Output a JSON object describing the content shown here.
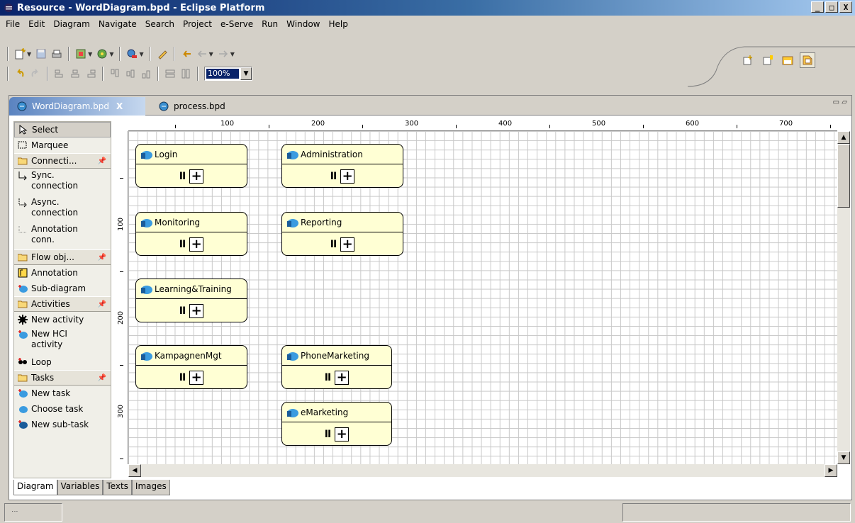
{
  "window": {
    "title": "Resource - WordDiagram.bpd - Eclipse Platform",
    "min_label": "_",
    "max_label": "□",
    "close_label": "X"
  },
  "menu": [
    {
      "label": "File"
    },
    {
      "label": "Edit"
    },
    {
      "label": "Diagram"
    },
    {
      "label": "Navigate"
    },
    {
      "label": "Search"
    },
    {
      "label": "Project"
    },
    {
      "label": "e-Serve"
    },
    {
      "label": "Run"
    },
    {
      "label": "Window"
    },
    {
      "label": "Help"
    }
  ],
  "toolbar": {
    "zoom_value": "100%"
  },
  "editor": {
    "tabs": [
      {
        "label": "WordDiagram.bpd",
        "close": "X"
      },
      {
        "label": "process.bpd"
      }
    ]
  },
  "palette": {
    "select": "Select",
    "marquee": "Marquee",
    "drawers": {
      "connections": "Connecti...",
      "flow": "Flow obj...",
      "activities": "Activities",
      "tasks": "Tasks"
    },
    "sync": [
      "Sync.",
      "connection"
    ],
    "async": [
      "Async.",
      "connection"
    ],
    "annotation_conn": [
      "Annotation",
      "conn."
    ],
    "annotation": "Annotation",
    "sub_diagram": "Sub-diagram",
    "new_activity": "New activity",
    "new_hci": [
      "New HCI",
      "activity"
    ],
    "loop": "Loop",
    "new_task": "New task",
    "choose_task": "Choose task",
    "new_sub_task": "New sub-task"
  },
  "ruler": {
    "top": [
      "100",
      "200",
      "300",
      "400",
      "500",
      "600",
      "700"
    ],
    "left": [
      "100",
      "200",
      "300"
    ]
  },
  "nodes": [
    {
      "name": "Login"
    },
    {
      "name": "Administration"
    },
    {
      "name": "Monitoring"
    },
    {
      "name": "Reporting"
    },
    {
      "name": "Learning&Training"
    },
    {
      "name": "KampagnenMgt"
    },
    {
      "name": "PhoneMarketing"
    },
    {
      "name": "eMarketing"
    }
  ],
  "bottom_tabs": [
    "Diagram",
    "Variables",
    "Texts",
    "Images"
  ],
  "colors": {
    "node_fill": "#ffffd4",
    "title_bar": "#0a246a",
    "active_tab": "#5a83c0"
  }
}
